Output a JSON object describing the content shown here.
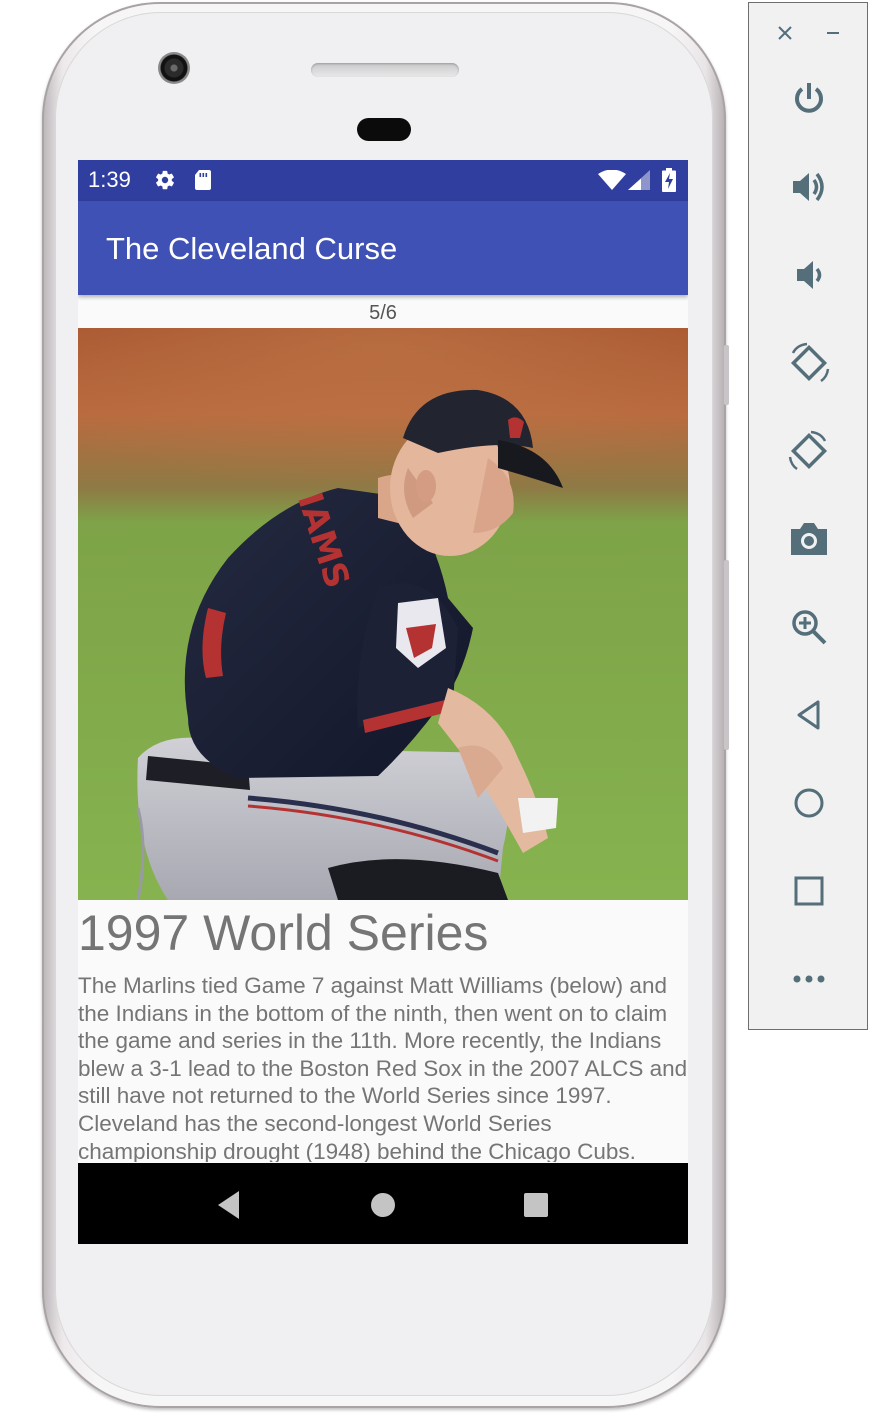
{
  "app": {
    "title": "The Cleveland Curse",
    "counter": "5/6"
  },
  "status_bar": {
    "time": "1:39",
    "icons": [
      "settings-icon",
      "sd-card-icon",
      "wifi-icon",
      "cell-signal-icon",
      "battery-charging-icon"
    ]
  },
  "slide": {
    "heading": "1997 World Series",
    "body": "The Marlins tied Game 7 against Matt Williams (below) and the Indians in the bottom of the ninth, then went on to claim the game and series in the 11th. More recently, the Indians blew a 3-1 lead to the Boston Red Sox in the 2007 ALCS and still have not returned to the World Series since 1997. Cleveland has the second-longest World Series championship drought (1948) behind the Chicago Cubs."
  },
  "nav_bar": {
    "buttons": [
      "back-icon",
      "home-icon",
      "recents-icon"
    ]
  },
  "emulator_toolbar": {
    "window_controls": [
      "close-icon",
      "minimize-icon"
    ],
    "buttons": [
      "power-icon",
      "volume-up-icon",
      "volume-down-icon",
      "rotate-left-icon",
      "rotate-right-icon",
      "camera-icon",
      "zoom-icon",
      "back-icon",
      "home-icon",
      "overview-icon",
      "more-icon"
    ]
  },
  "colors": {
    "status_bar": "#303f9f",
    "app_bar": "#3f51b5",
    "text_secondary": "#757575",
    "toolbar_icon": "#546e7a"
  }
}
